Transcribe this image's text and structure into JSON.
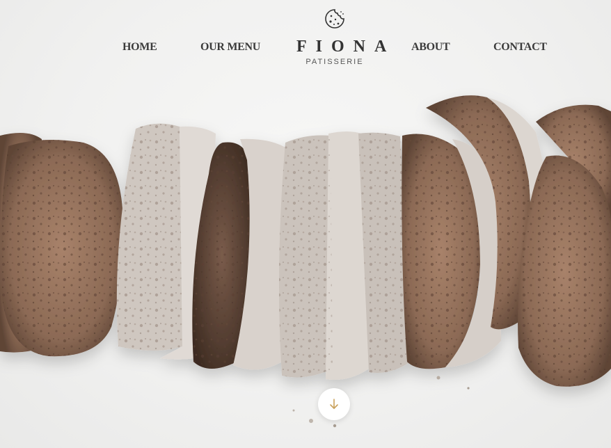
{
  "nav": {
    "home": "HOME",
    "menu": "OUR MENU",
    "about": "ABOUT",
    "contact": "CONTACT"
  },
  "logo": {
    "icon": "cookie-icon",
    "name": "FIONA",
    "subtitle": "PATISSERIE"
  },
  "hero": {
    "image": "sliced-bread-loaf",
    "scroll_icon": "arrow-down-icon"
  },
  "colors": {
    "text": "#3b3b3b",
    "accent": "#c9a15b",
    "background": "#f2f2f1"
  }
}
